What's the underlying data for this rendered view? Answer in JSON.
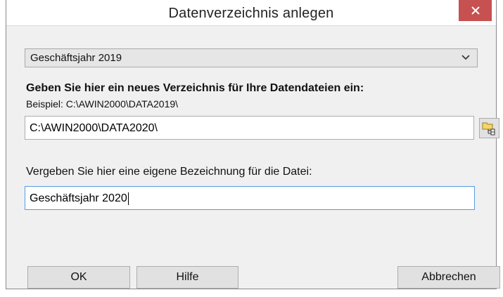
{
  "window": {
    "title": "Datenverzeichnis anlegen",
    "close_icon": "close-icon"
  },
  "year_select": {
    "selected": "Geschäftsjahr 2019",
    "icon": "chevron-down-icon"
  },
  "directory": {
    "heading": "Geben Sie hier ein neues Verzeichnis für Ihre Datendateien ein:",
    "example": "Beispiel: C:\\AWIN2000\\DATA2019\\",
    "value": "C:\\AWIN2000\\DATA2020\\",
    "browse_icon": "folder-tree-icon"
  },
  "description": {
    "label": "Vergeben Sie hier eine eigene Bezeichnung für die Datei:",
    "value": "Geschäftsjahr 2020"
  },
  "buttons": {
    "ok": "OK",
    "help": "Hilfe",
    "cancel": "Abbrechen"
  },
  "colors": {
    "close_button": "#c75050",
    "focus_border": "#569de5",
    "dialog_background": "#f0f0f0"
  }
}
